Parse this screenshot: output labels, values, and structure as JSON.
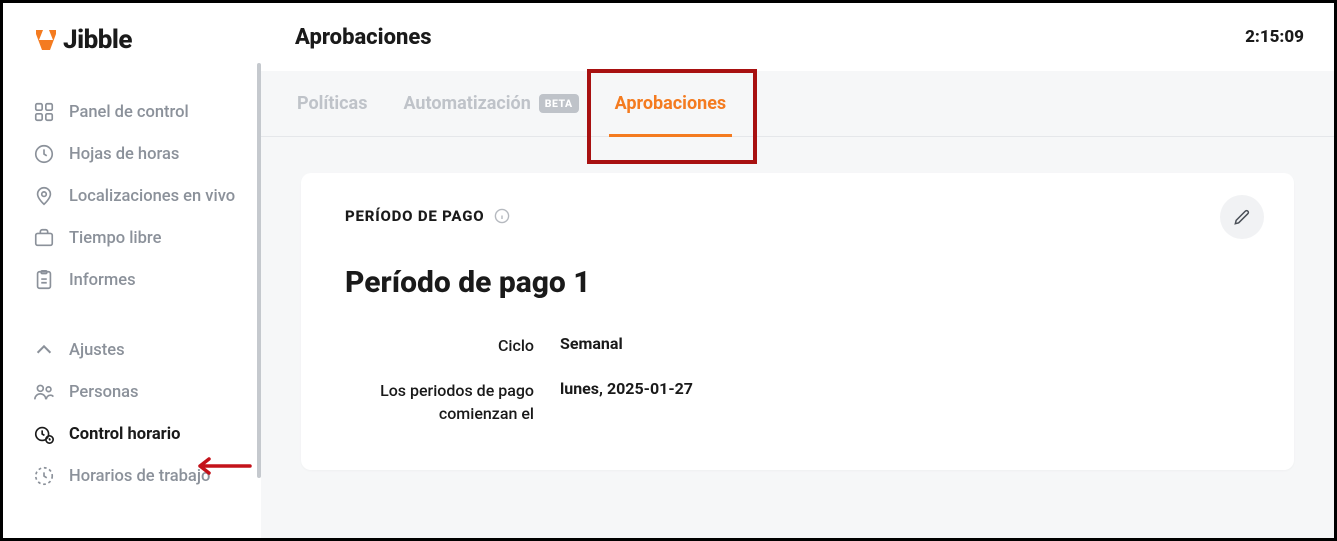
{
  "app": {
    "name": "Jibble"
  },
  "timer": "2:15:09",
  "page": {
    "title": "Aprobaciones"
  },
  "sidebar": {
    "section1": [
      {
        "label": "Panel de control"
      },
      {
        "label": "Hojas de horas"
      },
      {
        "label": "Localizaciones en vivo"
      },
      {
        "label": "Tiempo libre"
      },
      {
        "label": "Informes"
      }
    ],
    "section2": [
      {
        "label": "Ajustes"
      },
      {
        "label": "Personas"
      },
      {
        "label": "Control horario",
        "active": true
      },
      {
        "label": "Horarios de trabajo"
      }
    ]
  },
  "tabs": [
    {
      "label": "Políticas"
    },
    {
      "label": "Automatización",
      "badge": "BETA"
    },
    {
      "label": "Aprobaciones",
      "active": true
    }
  ],
  "card": {
    "header": "PERÍODO DE PAGO",
    "title": "Período de pago 1",
    "fields": [
      {
        "label": "Ciclo",
        "value": "Semanal"
      },
      {
        "label": "Los periodos de pago comienzan el",
        "value": "lunes, 2025-01-27"
      }
    ]
  },
  "colors": {
    "accent": "#f47b20",
    "highlight": "#a81111"
  }
}
